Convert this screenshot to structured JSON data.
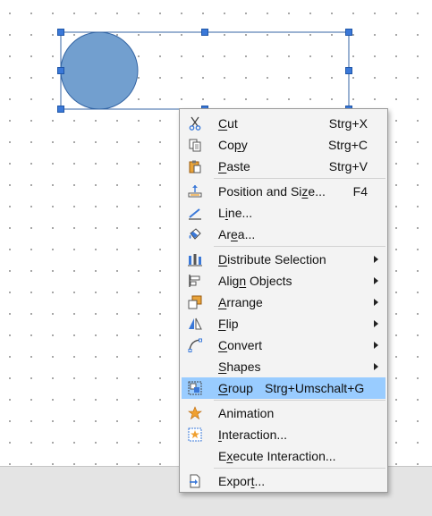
{
  "menu": {
    "items": [
      {
        "name": "cut",
        "icon": "scissors-icon",
        "before": "",
        "key": "C",
        "after": "ut",
        "shortcut": "Strg+X",
        "submenu": false,
        "highlight": false
      },
      {
        "name": "copy",
        "icon": "copy-icon",
        "before": "Co",
        "key": "p",
        "after": "y",
        "shortcut": "Strg+C",
        "submenu": false,
        "highlight": false
      },
      {
        "name": "paste",
        "icon": "clipboard-icon",
        "before": "",
        "key": "P",
        "after": "aste",
        "shortcut": "Strg+V",
        "submenu": false,
        "highlight": false
      },
      {
        "name": "position-and-size",
        "icon": "position-size-icon",
        "before": "Position and Si",
        "key": "z",
        "after": "e...",
        "shortcut": "F4",
        "submenu": false,
        "highlight": false
      },
      {
        "name": "line",
        "icon": "line-style-icon",
        "before": "L",
        "key": "i",
        "after": "ne...",
        "shortcut": "",
        "submenu": false,
        "highlight": false
      },
      {
        "name": "area",
        "icon": "paint-bucket-icon",
        "before": "Ar",
        "key": "e",
        "after": "a...",
        "shortcut": "",
        "submenu": false,
        "highlight": false
      },
      {
        "name": "distribute-selection",
        "icon": "distribute-icon",
        "before": "",
        "key": "D",
        "after": "istribute Selection",
        "shortcut": "",
        "submenu": true,
        "highlight": false
      },
      {
        "name": "align-objects",
        "icon": "align-icon",
        "before": "Alig",
        "key": "n",
        "after": " Objects",
        "shortcut": "",
        "submenu": true,
        "highlight": false
      },
      {
        "name": "arrange",
        "icon": "arrange-icon",
        "before": "",
        "key": "A",
        "after": "rrange",
        "shortcut": "",
        "submenu": true,
        "highlight": false
      },
      {
        "name": "flip",
        "icon": "flip-icon",
        "before": "",
        "key": "F",
        "after": "lip",
        "shortcut": "",
        "submenu": true,
        "highlight": false
      },
      {
        "name": "convert",
        "icon": "convert-curve-icon",
        "before": "",
        "key": "C",
        "after": "onvert",
        "shortcut": "",
        "submenu": true,
        "highlight": false
      },
      {
        "name": "shapes",
        "icon": "",
        "before": "",
        "key": "S",
        "after": "hapes",
        "shortcut": "",
        "submenu": true,
        "highlight": false
      },
      {
        "name": "group",
        "icon": "group-icon",
        "before": "",
        "key": "G",
        "after": "roup",
        "shortcut": "Strg+Umschalt+G",
        "submenu": false,
        "highlight": true
      },
      {
        "name": "animation",
        "icon": "animation-star-icon",
        "before": "Animation",
        "key": "",
        "after": "",
        "shortcut": "",
        "submenu": false,
        "highlight": false
      },
      {
        "name": "interaction",
        "icon": "interaction-icon",
        "before": "",
        "key": "I",
        "after": "nteraction...",
        "shortcut": "",
        "submenu": false,
        "highlight": false
      },
      {
        "name": "execute-interaction",
        "icon": "",
        "before": "E",
        "key": "x",
        "after": "ecute Interaction...",
        "shortcut": "",
        "submenu": false,
        "highlight": false
      },
      {
        "name": "export",
        "icon": "export-icon",
        "before": "Expor",
        "key": "t",
        "after": "...",
        "shortcut": "",
        "submenu": false,
        "highlight": false
      }
    ]
  },
  "colors": {
    "shape_fill": "#729fcf",
    "selection": "#3465a4",
    "highlight": "#99ccff",
    "menu_bg": "#f3f3f3"
  }
}
